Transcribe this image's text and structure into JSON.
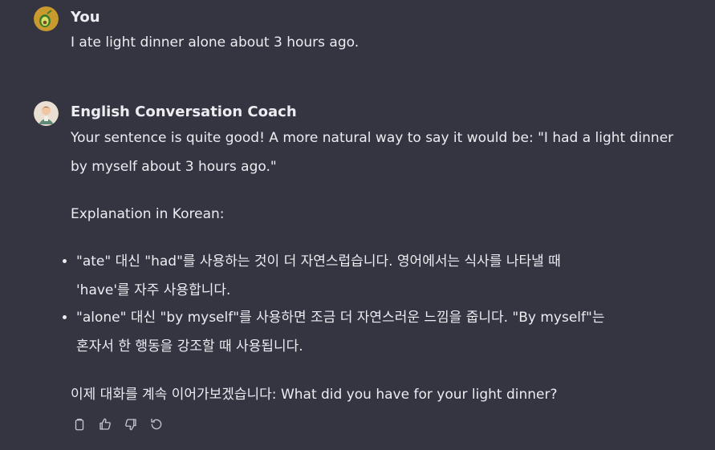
{
  "user_message": {
    "author": "You",
    "text": "I ate light dinner alone about 3 hours ago.",
    "avatar_icon": "avocado-icon"
  },
  "assistant_message": {
    "author": "English Conversation Coach",
    "avatar_icon": "coach-portrait-icon",
    "line1": "Your sentence is quite good! A more natural way to say it would be: \"I had a light dinner",
    "line2": "by myself about 3 hours ago.\"",
    "explanation_heading": "Explanation in Korean:",
    "bullets": [
      {
        "line1": "\"ate\" 대신 \"had\"를 사용하는 것이 더 자연스럽습니다. 영어에서는 식사를 나타낼 때",
        "line2": "'have'를 자주 사용합니다."
      },
      {
        "line1": "\"alone\" 대신 \"by myself\"를 사용하면 조금 더 자연스러운 느낌을 줍니다. \"By myself\"는",
        "line2": "혼자서 한 행동을 강조할 때 사용됩니다."
      }
    ],
    "closing": "이제 대화를 계속 이어가보겠습니다: What did you have for your light dinner?"
  },
  "actions": {
    "icons": [
      "copy-icon",
      "thumbs-up-icon",
      "thumbs-down-icon",
      "regenerate-icon"
    ]
  },
  "colors": {
    "background": "#343541",
    "text": "#ececf1",
    "icon": "#c5c5d2"
  }
}
